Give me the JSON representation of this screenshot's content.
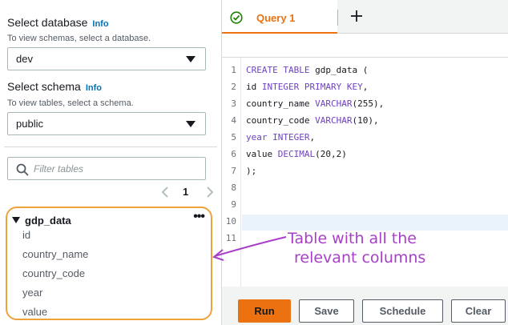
{
  "sidebar": {
    "database": {
      "heading": "Select database",
      "info": "Info",
      "subtitle": "To view schemas, select a database.",
      "selected": "dev"
    },
    "schema": {
      "heading": "Select schema",
      "info": "Info",
      "subtitle": "To view tables, select a schema.",
      "selected": "public"
    },
    "filter": {
      "placeholder": "Filter tables"
    },
    "pagination": {
      "page": "1"
    },
    "table": {
      "name": "gdp_data",
      "menu": "•••",
      "columns": [
        "id",
        "country_name",
        "country_code",
        "year",
        "value"
      ]
    }
  },
  "editor": {
    "tab_label": "Query 1",
    "line_numbers": [
      "1",
      "2",
      "3",
      "4",
      "5",
      "6",
      "7",
      "8",
      "9",
      "10",
      "11"
    ],
    "code": [
      {
        "kw": "CREATE TABLE",
        "rest": " gdp_data ("
      },
      {
        "pre": "id ",
        "kw": "INTEGER PRIMARY KEY",
        "rest": ","
      },
      {
        "pre": "country_name ",
        "kw": "VARCHAR",
        "rest": "(255),"
      },
      {
        "pre": "country_code ",
        "kw": "VARCHAR",
        "rest": "(10),"
      },
      {
        "kw": "year INTEGER",
        "rest": ","
      },
      {
        "pre": "value ",
        "kw": "DECIMAL",
        "rest": "(20,2)"
      },
      {
        "rest": ");"
      }
    ],
    "buttons": {
      "run": "Run",
      "save": "Save",
      "schedule": "Schedule",
      "clear": "Clear"
    }
  },
  "annotation": {
    "line1": "Table with all the",
    "line2": "relevant columns"
  },
  "colors": {
    "accent": "#ec7211",
    "info_link": "#0073bb",
    "keyword": "#6f42c1",
    "annotation": "#a93fc9",
    "highlight_border": "#f0a23a"
  }
}
